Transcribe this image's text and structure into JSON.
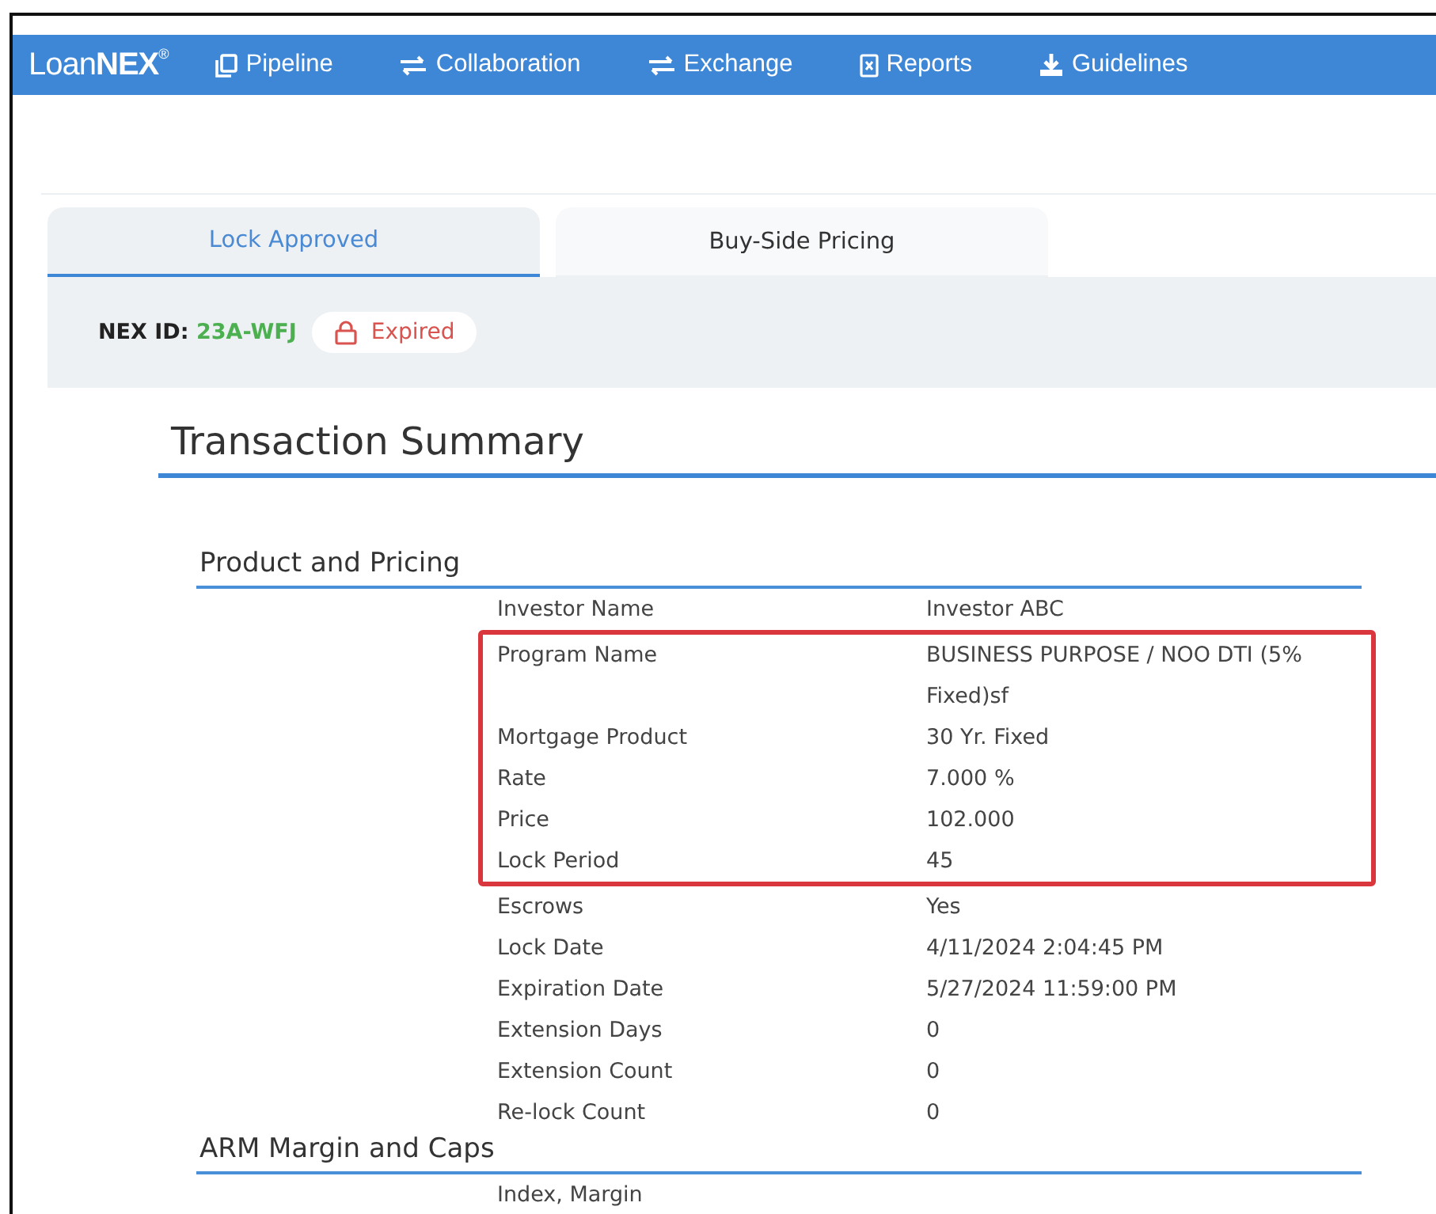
{
  "nav": {
    "logo": "Loan**NEX**$^{®}$",
    "items": [
      {
        "label": "Pipeline"
      },
      {
        "label": "Collaboration"
      },
      {
        "label": "Exchange"
      },
      {
        "label": "Reports"
      },
      {
        "label": "Guidelines"
      }
    ]
  },
  "tabs": [
    {
      "label": "Lock Approved",
      "selected": true
    },
    {
      "label": "Buy-Side Pricing",
      "selected": false
    }
  ],
  "id_bar": {
    "label": "NEX ID:",
    "value": "23A-WFJ",
    "status": "Expired"
  },
  "title": "Transaction Summary",
  "sections": [
    {
      "heading": "Product and Pricing",
      "rows": [
        {
          "label": "Investor Name",
          "value": "Investor ABC",
          "highlighted": false
        },
        {
          "label": "Program Name",
          "value": "BUSINESS PURPOSE / NOO DTI (5% Fixed)sf",
          "highlighted": true
        },
        {
          "label": "Mortgage Product",
          "value": "30 Yr. Fixed",
          "highlighted": true
        },
        {
          "label": "Rate",
          "value": "7.000 %",
          "highlighted": true
        },
        {
          "label": "Price",
          "value": "102.000",
          "highlighted": true
        },
        {
          "label": "Lock Period",
          "value": "45",
          "highlighted": true
        },
        {
          "label": "Escrows",
          "value": "Yes",
          "highlighted": false
        },
        {
          "label": "Lock Date",
          "value": "4/11/2024 2:04:45 PM",
          "highlighted": false
        },
        {
          "label": "Expiration Date",
          "value": "5/27/2024 11:59:00 PM",
          "highlighted": false
        },
        {
          "label": "Extension Days",
          "value": "0",
          "highlighted": false
        },
        {
          "label": "Extension Count",
          "value": "0",
          "highlighted": false
        },
        {
          "label": "Re-lock Count",
          "value": "0",
          "highlighted": false
        }
      ]
    },
    {
      "heading": "ARM Margin and Caps",
      "rows": [
        {
          "label": "Index, Margin",
          "highlighted": false
        }
      ]
    }
  ]
}
